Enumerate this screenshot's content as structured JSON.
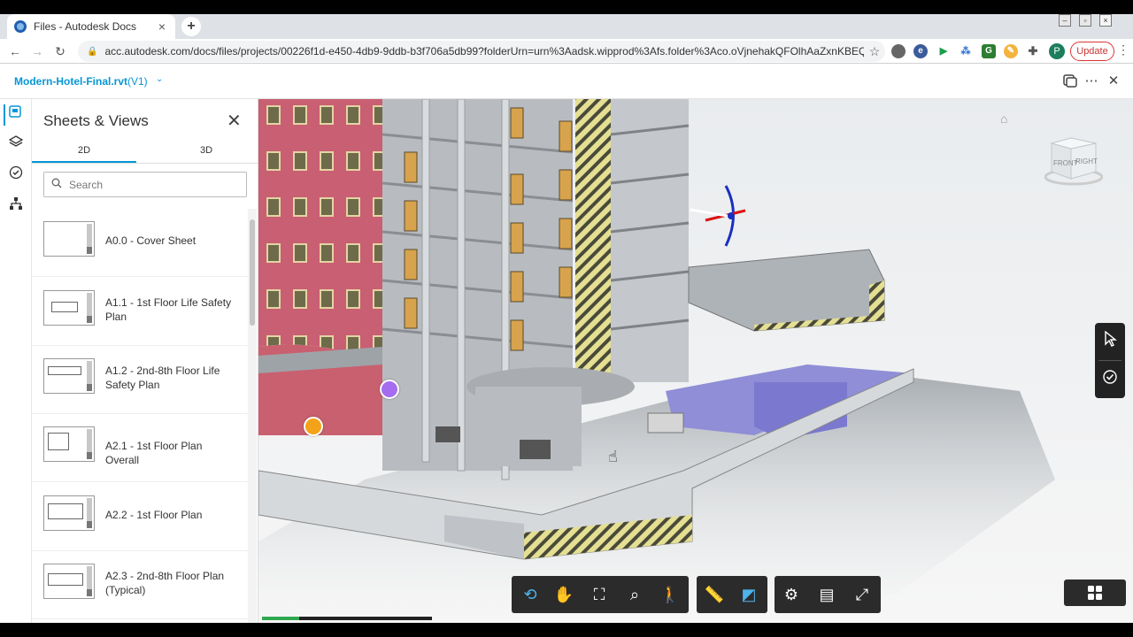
{
  "browser": {
    "tab_title": "Files - Autodesk Docs",
    "tab_close": "×",
    "new_tab": "+",
    "url": "acc.autodesk.com/docs/files/projects/00226f1d-e450-4db9-9ddb-b3f706a5db99?folderUrn=urn%3Aadsk.wipprod%3Afs.folder%3Aco.oVjnehakQFOlhAaZxnKBEQ&entityId...",
    "profile_initial": "P",
    "update_label": "Update",
    "back": "←",
    "forward": "→",
    "reload": "↻",
    "menu": "⋮",
    "bookmark": "☆"
  },
  "app": {
    "file_name": "Modern-Hotel-Final.rvt",
    "version": "(V1)",
    "version_chevron": "⌄",
    "more_label": "⋯",
    "close_label": "✕"
  },
  "panel": {
    "title": "Sheets & Views",
    "close": "✕",
    "tabs": [
      {
        "label": "2D",
        "active": true
      },
      {
        "label": "3D",
        "active": false
      }
    ],
    "search_placeholder": "Search",
    "sheets": [
      {
        "name": "A0.0 - Cover Sheet"
      },
      {
        "name": "A1.1 - 1st Floor Life Safety Plan"
      },
      {
        "name": "A1.2 - 2nd-8th Floor Life Safety Plan"
      },
      {
        "name": "A2.1 - 1st Floor Plan Overall"
      },
      {
        "name": "A2.2 - 1st Floor Plan"
      },
      {
        "name": "A2.3 - 2nd-8th Floor Plan (Typical)"
      }
    ]
  },
  "viewer": {
    "viewcube_front": "FRONT",
    "viewcube_right": "RIGHT",
    "load_progress": 0.22,
    "toolbar_icons": [
      "orbit-icon",
      "pan-icon",
      "fit-to-view-icon",
      "zoom-window-icon",
      "first-person-icon",
      "measure-icon",
      "section-icon",
      "settings-icon",
      "properties-icon",
      "fullscreen-icon"
    ],
    "markers": [
      {
        "color": "#a56cf0"
      },
      {
        "color": "#f5a21b"
      }
    ]
  },
  "colors": {
    "accent": "#0696d7",
    "toolbar_bg": "#2b2b2b",
    "update_red": "#d33333"
  }
}
